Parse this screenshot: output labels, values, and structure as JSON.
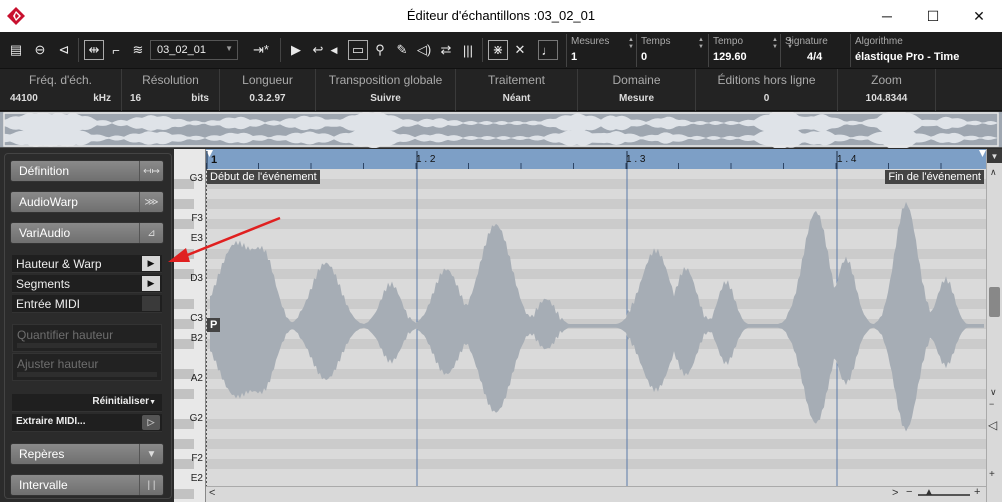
{
  "window": {
    "title": "Éditeur d'échantillons :03_02_01",
    "minimize": "─",
    "maximize": "☐",
    "close": "✕"
  },
  "toolbar": {
    "track_name": "03_02_01",
    "fields": [
      {
        "label": "Mesures",
        "value": "1"
      },
      {
        "label": "Temps",
        "value": "0"
      },
      {
        "label": "Tempo",
        "value": "129.60"
      },
      {
        "label": "Signature",
        "value": "4/4"
      },
      {
        "label": "Algorithme",
        "value": "élastique Pro - Time"
      }
    ],
    "icons": [
      "show-info-icon",
      "solo-icon",
      "speaker-icon",
      "snap-range-icon",
      "marker-icon",
      "stack-icon",
      "jump-play-icon",
      "play-icon",
      "loop-icon",
      "marker-triangle-icon",
      "select-tool-icon",
      "zoom-tool-icon",
      "draw-tool-icon",
      "speaker-tool-icon",
      "timewarp-icon",
      "grid-icon",
      "snap-icon",
      "crossfade-icon",
      "note-icon"
    ]
  },
  "infoline": [
    {
      "label": "Fréq. d'éch.",
      "value": "44100",
      "unit": "kHz"
    },
    {
      "label": "Résolution",
      "value": "16",
      "unit": "bits"
    },
    {
      "label": "Longueur",
      "value": "0.3.2.97"
    },
    {
      "label": "Transposition globale",
      "value": "Suivre"
    },
    {
      "label": "Traitement",
      "value": "Néant"
    },
    {
      "label": "Domaine",
      "value": "Mesure"
    },
    {
      "label": "Éditions hors ligne",
      "value": "0"
    },
    {
      "label": "Zoom",
      "value": "104.8344"
    }
  ],
  "panel": {
    "definition": "Définition",
    "audiowarp": "AudioWarp",
    "variaudio": "VariAudio",
    "pitch_warp": "Hauteur & Warp",
    "segments": "Segments",
    "midi_input": "Entrée MIDI",
    "quantize_pitch": "Quantifier hauteur",
    "straighten_pitch": "Ajuster hauteur",
    "reset": "Réinitialiser",
    "extract_midi": "Extraire MIDI...",
    "markers": "Repères",
    "range": "Intervalle"
  },
  "keys": [
    "G3",
    "F3",
    "E3",
    "D3",
    "C3",
    "B2",
    "A2",
    "G2",
    "F2",
    "E2"
  ],
  "ruler": {
    "marks": [
      "1",
      "1 . 2",
      "1 . 3",
      "1 . 4"
    ]
  },
  "editor": {
    "event_start": "Début de l'événement",
    "event_end": "Fin de l'événement",
    "p_marker": "P",
    "accent": "#7d9fc6",
    "waveform_color": "#a6adb5",
    "arrow_color": "#e02020"
  }
}
